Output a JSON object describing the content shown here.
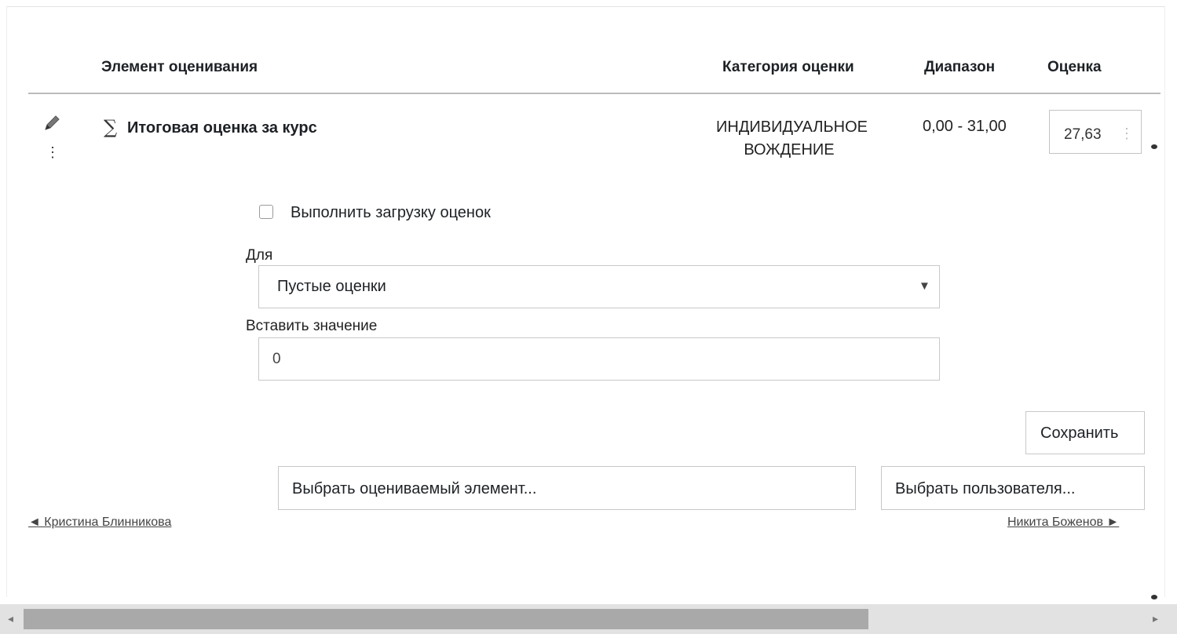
{
  "table": {
    "headers": {
      "item": "Элемент оценивания",
      "category": "Категория оценки",
      "range": "Диапазон",
      "grade": "Оценка"
    },
    "row": {
      "edit_icon": "pencil-icon",
      "actions_icon": "kebab-menu-icon",
      "sigma_icon": "∑",
      "name": "Итоговая оценка за курс",
      "category": "ИНДИВИДУАЛЬНОЕ ВОЖДЕНИЕ",
      "range": "0,00 - 31,00",
      "grade_value": "27,63"
    }
  },
  "bulk": {
    "checkbox_label": "Выполнить загрузку оценок",
    "checkbox_checked": false,
    "for_label": "Для",
    "for_selected": "Пустые оценки",
    "insert_label": "Вставить значение",
    "insert_value": "0"
  },
  "actions": {
    "save_label": "Сохранить",
    "select_item_label": "Выбрать оцениваемый элемент...",
    "select_user_label": "Выбрать пользователя..."
  },
  "navigation": {
    "prev_user": "◄ Кристина Блинникова",
    "next_user": "Никита Боженов ►"
  }
}
